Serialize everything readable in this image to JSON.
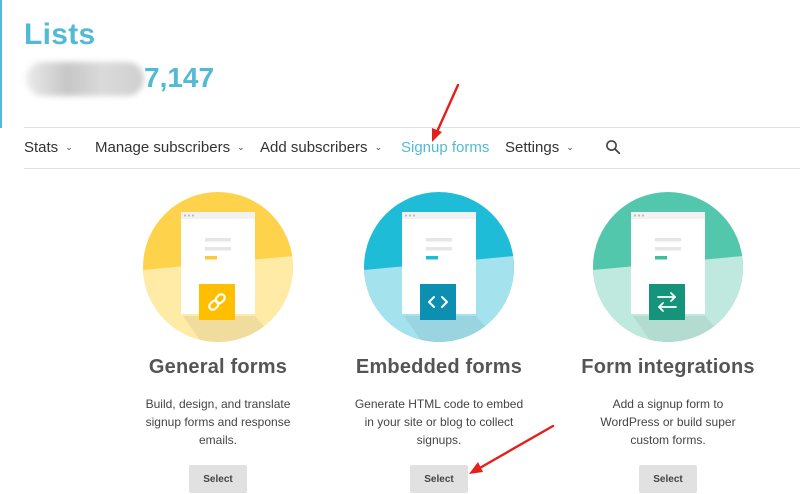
{
  "page": {
    "title": "Lists",
    "subscriber_count": "7,147"
  },
  "nav": {
    "items": [
      {
        "label": "Stats",
        "has_caret": true
      },
      {
        "label": "Manage subscribers",
        "has_caret": true
      },
      {
        "label": "Add subscribers",
        "has_caret": true
      },
      {
        "label": "Signup forms",
        "active": true
      },
      {
        "label": "Settings",
        "has_caret": true
      }
    ],
    "caret_glyph": "⌄",
    "search_icon": "search-icon"
  },
  "cards": [
    {
      "title": "General forms",
      "description": "Build, design, and translate signup forms and response emails.",
      "button": "Select",
      "color": "#ffd24c",
      "icon": "link-icon"
    },
    {
      "title": "Embedded forms",
      "description": "Generate HTML code to embed in your site or blog to collect signups.",
      "button": "Select",
      "color": "#1fbcd8",
      "icon": "code-icon"
    },
    {
      "title": "Form integrations",
      "description": "Add a signup form to WordPress or build super custom forms.",
      "button": "Select",
      "color": "#52c7ac",
      "icon": "swap-arrows-icon"
    }
  ],
  "colors": {
    "accent": "#52bad5",
    "annotation": "#e3201b"
  }
}
